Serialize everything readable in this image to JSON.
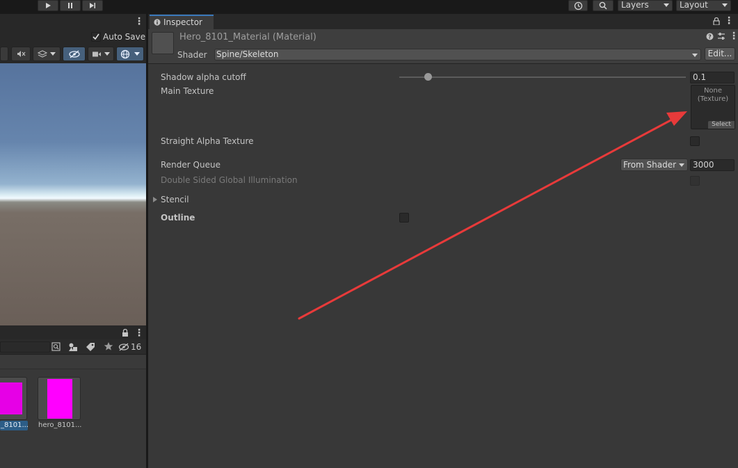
{
  "toolbar": {
    "layers_label": "Layers",
    "layout_label": "Layout"
  },
  "scene": {
    "auto_save_label": "Auto Save",
    "auto_save_checked": true
  },
  "project": {
    "hidden_count": "16",
    "assets": [
      {
        "label": "_8101...",
        "selected": true,
        "swatch": "#e600e6"
      },
      {
        "label": "hero_8101...",
        "selected": false,
        "swatch": "#ff00ff"
      }
    ]
  },
  "inspector": {
    "tab_label": "Inspector",
    "material_title": "Hero_8101_Material (Material)",
    "shader_label": "Shader",
    "shader_value": "Spine/Skeleton",
    "edit_label": "Edit...",
    "properties": {
      "shadow_alpha_cutoff": {
        "label": "Shadow alpha cutoff",
        "value": "0.1",
        "slider_fraction": 0.1
      },
      "main_texture": {
        "label": "Main Texture",
        "slot_line1": "None",
        "slot_line2": "(Texture)",
        "select_label": "Select"
      },
      "straight_alpha": {
        "label": "Straight Alpha Texture"
      },
      "render_queue": {
        "label": "Render Queue",
        "mode": "From Shader",
        "value": "3000"
      },
      "double_sided_gi": {
        "label": "Double Sided Global Illumination"
      },
      "stencil": {
        "label": "Stencil"
      },
      "outline": {
        "label": "Outline"
      }
    }
  },
  "annotation": {
    "arrow_color": "#e83a3a"
  }
}
